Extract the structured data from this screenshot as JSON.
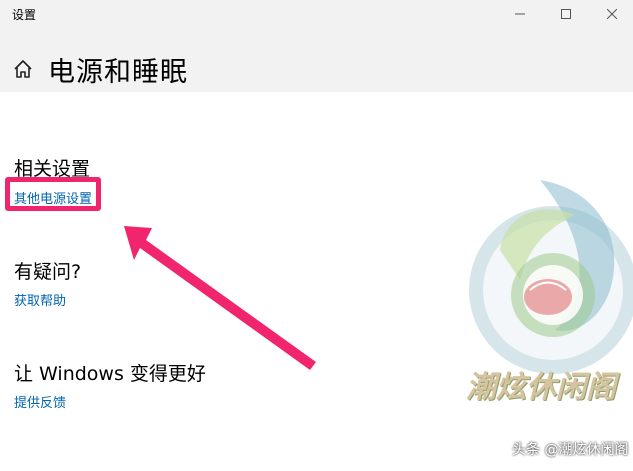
{
  "window": {
    "app_title": "设置",
    "minimize_glyph": "—",
    "maximize_glyph": "☐",
    "close_glyph": "✕"
  },
  "header": {
    "icon": "home-icon",
    "title": "电源和睡眠"
  },
  "sections": {
    "related": {
      "title": "相关设置",
      "link": "其他电源设置"
    },
    "question": {
      "title": "有疑问?",
      "link": "获取帮助"
    },
    "windows": {
      "title": "让 Windows 变得更好",
      "link": "提供反馈"
    }
  },
  "annotation": {
    "highlight_color": "#f0256e",
    "arrow_color": "#f0256e"
  },
  "watermark": {
    "logo_text": "潮炫休闲阁",
    "credit": "头条 @潮炫休闲阁"
  },
  "colors": {
    "link": "#0063b1",
    "titlebar": "#f2f2f2"
  }
}
